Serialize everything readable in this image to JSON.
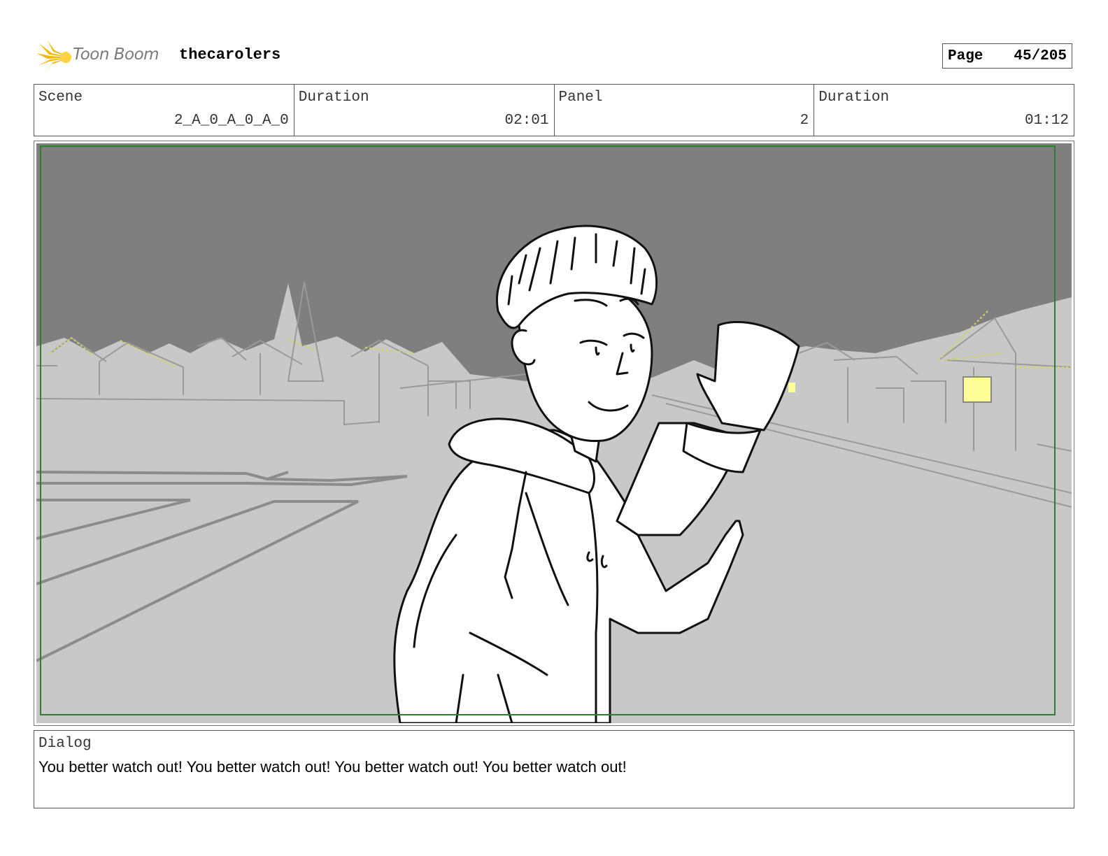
{
  "header": {
    "brand": "Toon Boom",
    "project": "thecarolers",
    "page_label": "Page",
    "page_number": "45/205"
  },
  "info": {
    "scene_label": "Scene",
    "scene_value": "2_A_0_A_0_A_0",
    "scene_duration_label": "Duration",
    "scene_duration_value": "02:01",
    "panel_label": "Panel",
    "panel_value": "2",
    "panel_duration_label": "Duration",
    "panel_duration_value": "01:12"
  },
  "panel": {
    "safe_frame_color": "#2e7d32",
    "sky_color": "#7f7f7f",
    "ground_color": "#c8c8c8",
    "light_color": "#ffff99"
  },
  "dialog": {
    "label": "Dialog",
    "text": "You better watch out! You better watch out! You better watch out! You better watch out!"
  }
}
